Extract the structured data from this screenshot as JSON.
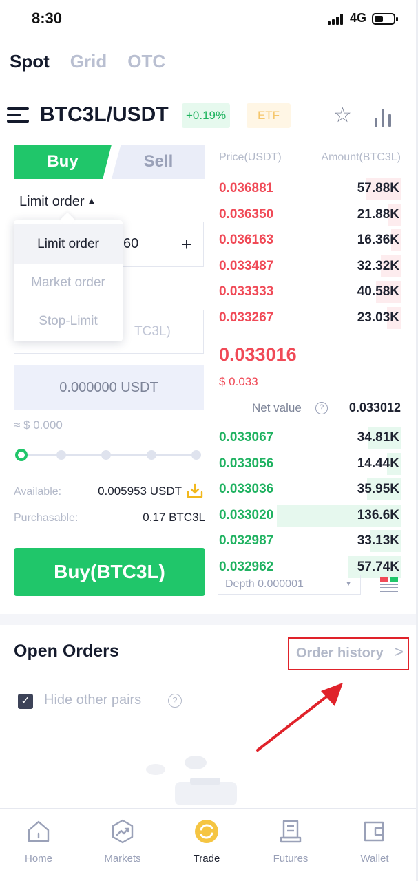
{
  "status_bar": {
    "time": "8:30",
    "network": "4G"
  },
  "mode_tabs": [
    {
      "label": "Spot",
      "active": true
    },
    {
      "label": "Grid",
      "active": false
    },
    {
      "label": "OTC",
      "active": false
    }
  ],
  "pair": {
    "name": "BTC3L/USDT",
    "change": "+0.19%",
    "badge": "ETF"
  },
  "trade_form": {
    "buy_tab": "Buy",
    "sell_tab": "Sell",
    "order_type": "Limit order",
    "price_value": "60",
    "plus": "+",
    "amount_placeholder": "TC3L)",
    "total": "0.000000 USDT",
    "approx": "≈ $ 0.000",
    "slider_level": 0,
    "available_label": "Available:",
    "available_value": "0.005953 USDT",
    "purchasable_label": "Purchasable:",
    "purchasable_value": "0.17 BTC3L",
    "buy_button": "Buy(BTC3L)"
  },
  "order_type_dropdown": {
    "options": [
      "Limit order",
      "Market order",
      "Stop-Limit"
    ],
    "selected": "Limit order"
  },
  "order_book": {
    "price_header": "Price(USDT)",
    "amount_header": "Amount(BTC3L)",
    "asks": [
      {
        "price": "0.036881",
        "amount": "57.88K",
        "depth": 0.42
      },
      {
        "price": "0.036350",
        "amount": "21.88K",
        "depth": 0.16
      },
      {
        "price": "0.036163",
        "amount": "16.36K",
        "depth": 0.12
      },
      {
        "price": "0.033487",
        "amount": "32.32K",
        "depth": 0.24
      },
      {
        "price": "0.033333",
        "amount": "40.58K",
        "depth": 0.3
      },
      {
        "price": "0.033267",
        "amount": "23.03K",
        "depth": 0.17
      }
    ],
    "last_price": "0.033016",
    "last_usd": "$ 0.033",
    "net_value_label": "Net value",
    "net_value": "0.033012",
    "bids": [
      {
        "price": "0.033067",
        "amount": "34.81K",
        "depth": 0.26
      },
      {
        "price": "0.033056",
        "amount": "14.44K",
        "depth": 0.11
      },
      {
        "price": "0.033036",
        "amount": "35.95K",
        "depth": 0.27
      },
      {
        "price": "0.033020",
        "amount": "136.6K",
        "depth": 1.0
      },
      {
        "price": "0.032987",
        "amount": "33.13K",
        "depth": 0.25
      },
      {
        "price": "0.032962",
        "amount": "57.74K",
        "depth": 0.42
      }
    ],
    "depth_select": "Depth 0.000001"
  },
  "open_orders": {
    "title": "Open Orders",
    "history_link": "Order history",
    "hide_pairs_label": "Hide other pairs",
    "hide_pairs_checked": true
  },
  "bottom_nav": [
    {
      "label": "Home",
      "icon": "home-icon",
      "active": false
    },
    {
      "label": "Markets",
      "icon": "markets-icon",
      "active": false
    },
    {
      "label": "Trade",
      "icon": "trade-icon",
      "active": true
    },
    {
      "label": "Futures",
      "icon": "futures-icon",
      "active": false
    },
    {
      "label": "Wallet",
      "icon": "wallet-icon",
      "active": false
    }
  ],
  "colors": {
    "buy_green": "#20c66a",
    "ask_red": "#f04a57",
    "highlight_red": "#e0222a"
  }
}
